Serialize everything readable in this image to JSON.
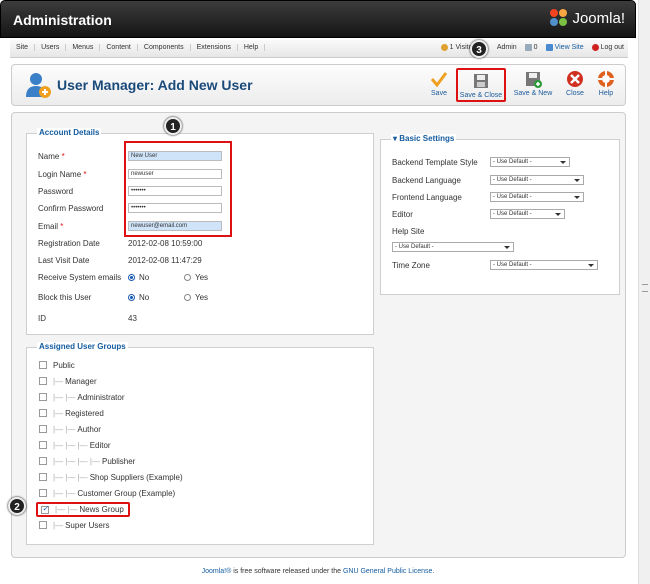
{
  "header": {
    "title": "Administration",
    "logo_text": "Joomla!"
  },
  "menu": {
    "items": [
      "Site",
      "Users",
      "Menus",
      "Content",
      "Components",
      "Extensions",
      "Help"
    ]
  },
  "status": {
    "visitor": "1 Visitor",
    "admin": "Admin",
    "messages": "0",
    "view_site": "View Site",
    "logout": "Log out"
  },
  "toolbar": {
    "title": "User Manager: Add New User",
    "buttons": [
      {
        "label": "Save",
        "color": "#f0a020"
      },
      {
        "label": "Save & Close",
        "color": "#666666"
      },
      {
        "label": "Save & New",
        "color": "#666666"
      },
      {
        "label": "Close",
        "color": "#d03020"
      },
      {
        "label": "Help",
        "color": "#e06020"
      }
    ]
  },
  "account": {
    "legend": "Account Details",
    "name_label": "Name",
    "name_value": "New User",
    "login_label": "Login Name",
    "login_value": "newuser",
    "password_label": "Password",
    "password_value": "•••••••",
    "confirm_label": "Confirm Password",
    "confirm_value": "•••••••",
    "email_label": "Email",
    "email_value": "newuser@email.com",
    "reg_label": "Registration Date",
    "reg_value": "2012-02-08 10:59:00",
    "visit_label": "Last Visit Date",
    "visit_value": "2012-02-08 11:47:29",
    "sys_label": "Receive System emails",
    "block_label": "Block this User",
    "no": "No",
    "yes": "Yes",
    "id_label": "ID",
    "id_value": "43"
  },
  "groups": {
    "legend": "Assigned User Groups",
    "items": [
      {
        "label": "Public",
        "depth": 0,
        "checked": false
      },
      {
        "label": "Manager",
        "depth": 1,
        "checked": false
      },
      {
        "label": "Administrator",
        "depth": 2,
        "checked": false
      },
      {
        "label": "Registered",
        "depth": 1,
        "checked": false
      },
      {
        "label": "Author",
        "depth": 2,
        "checked": false
      },
      {
        "label": "Editor",
        "depth": 3,
        "checked": false
      },
      {
        "label": "Publisher",
        "depth": 4,
        "checked": false
      },
      {
        "label": "Shop Suppliers (Example)",
        "depth": 3,
        "checked": false
      },
      {
        "label": "Customer Group (Example)",
        "depth": 2,
        "checked": false
      },
      {
        "label": "News Group",
        "depth": 2,
        "checked": true
      },
      {
        "label": "Super Users",
        "depth": 1,
        "checked": false
      }
    ]
  },
  "settings": {
    "legend": "▾ Basic Settings",
    "template_label": "Backend Template Style",
    "backlang_label": "Backend Language",
    "frontlang_label": "Frontend Language",
    "editor_label": "Editor",
    "helpsite_label": "Help Site",
    "timezone_label": "Time Zone",
    "default_option": "- Use Default -"
  },
  "badges": [
    "1",
    "2",
    "3"
  ],
  "footer": {
    "link": "Joomla!®",
    "text": " is free software released under the ",
    "license": "GNU General Public License",
    "end": "."
  }
}
